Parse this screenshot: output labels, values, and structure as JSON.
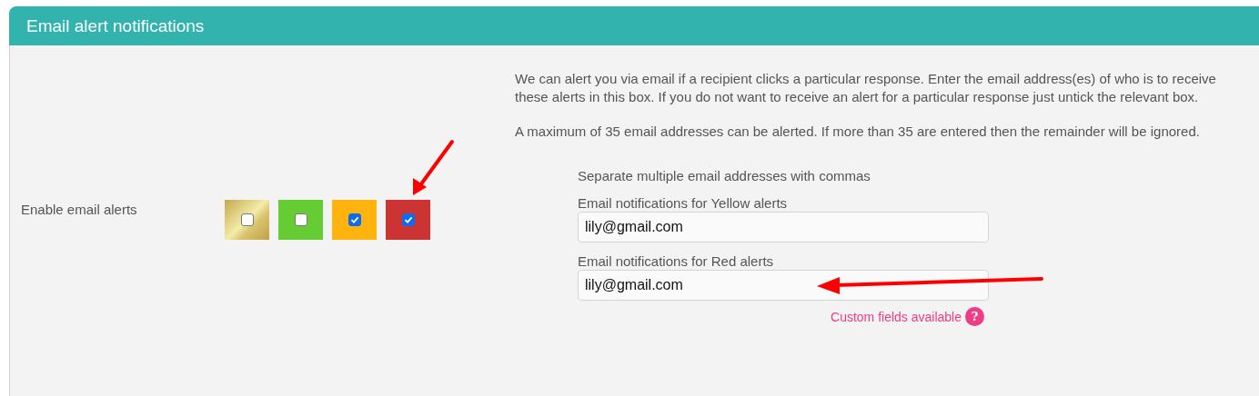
{
  "panel": {
    "title": "Email alert notifications"
  },
  "description": [
    "We can alert you via email if a recipient clicks a particular response. Enter the email address(es) of who is to receive these alerts in this box. If you do not want to receive an alert for a particular response just untick the relevant box.",
    "A maximum of 35 email addresses can be alerted. If more than 35 are entered then the remainder will be ignored."
  ],
  "enable_label": "Enable email alerts",
  "alerts": [
    {
      "kind": "gradient",
      "color": "#d9c46e",
      "checked": false
    },
    {
      "kind": "solid",
      "color": "#66cc33",
      "checked": false
    },
    {
      "kind": "solid",
      "color": "#ffb30f",
      "checked": true
    },
    {
      "kind": "solid",
      "color": "#cc3333",
      "checked": true
    }
  ],
  "hint": "Separate multiple email addresses with commas",
  "fields": [
    {
      "label": "Email notifications for Yellow alerts",
      "value": "lily@gmail.com"
    },
    {
      "label": "Email notifications for Red alerts",
      "value": "lily@gmail.com"
    }
  ],
  "custom_fields": {
    "text": "Custom fields available",
    "help": "?"
  }
}
